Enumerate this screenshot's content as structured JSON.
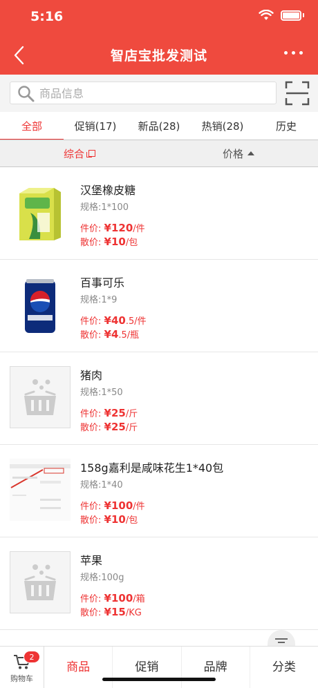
{
  "status": {
    "time": "5:16"
  },
  "header": {
    "title": "智店宝批发测试"
  },
  "search": {
    "placeholder": "商品信息"
  },
  "tabs": [
    "全部",
    "促销(17)",
    "新品(28)",
    "热销(28)",
    "历史"
  ],
  "sort": {
    "general": "综合",
    "price": "价格"
  },
  "products": [
    {
      "name": "汉堡橡皮糖",
      "spec": "规格:1*100",
      "p1_label": "件价: ",
      "p1_big": "¥120",
      "p1_small": "/件",
      "p2_label": "散价: ",
      "p2_big": "¥10",
      "p2_small": "/包",
      "image": "yellow-drink-box"
    },
    {
      "name": "百事可乐",
      "spec": "规格:1*9",
      "p1_label": "件价: ",
      "p1_big": "¥40",
      "p1_small": ".5/件",
      "p2_label": "散价: ",
      "p2_big": "¥4",
      "p2_small": ".5/瓶",
      "image": "pepsi-can"
    },
    {
      "name": "猪肉",
      "spec": "规格:1*50",
      "p1_label": "件价: ",
      "p1_big": "¥25",
      "p1_small": "/斤",
      "p2_label": "散价: ",
      "p2_big": "¥25",
      "p2_small": "/斤",
      "image": "placeholder-basket"
    },
    {
      "name": "158g嘉利是咸味花生1*40包",
      "spec": "规格:1*40",
      "p1_label": "件价: ",
      "p1_big": "¥100",
      "p1_small": "/件",
      "p2_label": "散价: ",
      "p2_big": "¥10",
      "p2_small": "/包",
      "image": "screenshot-thumbnail"
    },
    {
      "name": "苹果",
      "spec": "规格:100g",
      "p1_label": "件价: ",
      "p1_big": "¥100",
      "p1_small": "/箱",
      "p2_label": "散价: ",
      "p2_big": "¥15",
      "p2_small": "/KG",
      "image": "placeholder-basket"
    }
  ],
  "cart": {
    "label": "购物车",
    "count": "2"
  },
  "bottom_tabs": [
    "商品",
    "促销",
    "品牌",
    "分类"
  ],
  "colors": {
    "accent": "#ef4a3e"
  }
}
